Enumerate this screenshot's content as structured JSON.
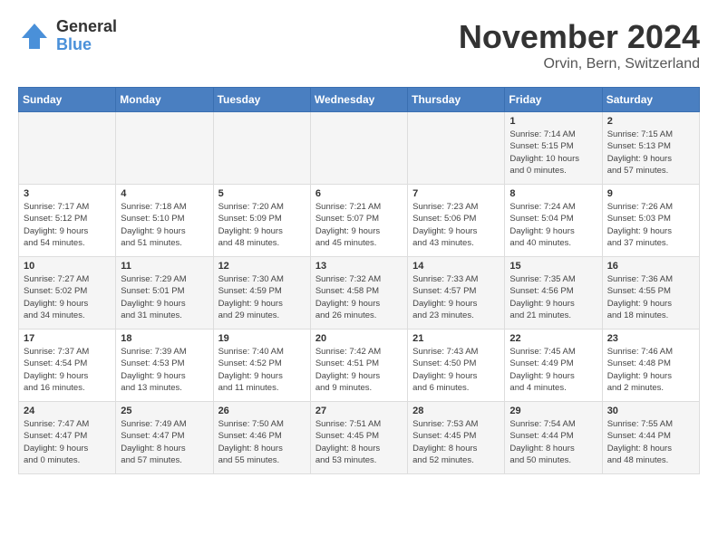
{
  "logo": {
    "general": "General",
    "blue": "Blue"
  },
  "title": "November 2024",
  "location": "Orvin, Bern, Switzerland",
  "days_of_week": [
    "Sunday",
    "Monday",
    "Tuesday",
    "Wednesday",
    "Thursday",
    "Friday",
    "Saturday"
  ],
  "weeks": [
    [
      {
        "day": "",
        "info": ""
      },
      {
        "day": "",
        "info": ""
      },
      {
        "day": "",
        "info": ""
      },
      {
        "day": "",
        "info": ""
      },
      {
        "day": "",
        "info": ""
      },
      {
        "day": "1",
        "info": "Sunrise: 7:14 AM\nSunset: 5:15 PM\nDaylight: 10 hours\nand 0 minutes."
      },
      {
        "day": "2",
        "info": "Sunrise: 7:15 AM\nSunset: 5:13 PM\nDaylight: 9 hours\nand 57 minutes."
      }
    ],
    [
      {
        "day": "3",
        "info": "Sunrise: 7:17 AM\nSunset: 5:12 PM\nDaylight: 9 hours\nand 54 minutes."
      },
      {
        "day": "4",
        "info": "Sunrise: 7:18 AM\nSunset: 5:10 PM\nDaylight: 9 hours\nand 51 minutes."
      },
      {
        "day": "5",
        "info": "Sunrise: 7:20 AM\nSunset: 5:09 PM\nDaylight: 9 hours\nand 48 minutes."
      },
      {
        "day": "6",
        "info": "Sunrise: 7:21 AM\nSunset: 5:07 PM\nDaylight: 9 hours\nand 45 minutes."
      },
      {
        "day": "7",
        "info": "Sunrise: 7:23 AM\nSunset: 5:06 PM\nDaylight: 9 hours\nand 43 minutes."
      },
      {
        "day": "8",
        "info": "Sunrise: 7:24 AM\nSunset: 5:04 PM\nDaylight: 9 hours\nand 40 minutes."
      },
      {
        "day": "9",
        "info": "Sunrise: 7:26 AM\nSunset: 5:03 PM\nDaylight: 9 hours\nand 37 minutes."
      }
    ],
    [
      {
        "day": "10",
        "info": "Sunrise: 7:27 AM\nSunset: 5:02 PM\nDaylight: 9 hours\nand 34 minutes."
      },
      {
        "day": "11",
        "info": "Sunrise: 7:29 AM\nSunset: 5:01 PM\nDaylight: 9 hours\nand 31 minutes."
      },
      {
        "day": "12",
        "info": "Sunrise: 7:30 AM\nSunset: 4:59 PM\nDaylight: 9 hours\nand 29 minutes."
      },
      {
        "day": "13",
        "info": "Sunrise: 7:32 AM\nSunset: 4:58 PM\nDaylight: 9 hours\nand 26 minutes."
      },
      {
        "day": "14",
        "info": "Sunrise: 7:33 AM\nSunset: 4:57 PM\nDaylight: 9 hours\nand 23 minutes."
      },
      {
        "day": "15",
        "info": "Sunrise: 7:35 AM\nSunset: 4:56 PM\nDaylight: 9 hours\nand 21 minutes."
      },
      {
        "day": "16",
        "info": "Sunrise: 7:36 AM\nSunset: 4:55 PM\nDaylight: 9 hours\nand 18 minutes."
      }
    ],
    [
      {
        "day": "17",
        "info": "Sunrise: 7:37 AM\nSunset: 4:54 PM\nDaylight: 9 hours\nand 16 minutes."
      },
      {
        "day": "18",
        "info": "Sunrise: 7:39 AM\nSunset: 4:53 PM\nDaylight: 9 hours\nand 13 minutes."
      },
      {
        "day": "19",
        "info": "Sunrise: 7:40 AM\nSunset: 4:52 PM\nDaylight: 9 hours\nand 11 minutes."
      },
      {
        "day": "20",
        "info": "Sunrise: 7:42 AM\nSunset: 4:51 PM\nDaylight: 9 hours\nand 9 minutes."
      },
      {
        "day": "21",
        "info": "Sunrise: 7:43 AM\nSunset: 4:50 PM\nDaylight: 9 hours\nand 6 minutes."
      },
      {
        "day": "22",
        "info": "Sunrise: 7:45 AM\nSunset: 4:49 PM\nDaylight: 9 hours\nand 4 minutes."
      },
      {
        "day": "23",
        "info": "Sunrise: 7:46 AM\nSunset: 4:48 PM\nDaylight: 9 hours\nand 2 minutes."
      }
    ],
    [
      {
        "day": "24",
        "info": "Sunrise: 7:47 AM\nSunset: 4:47 PM\nDaylight: 9 hours\nand 0 minutes."
      },
      {
        "day": "25",
        "info": "Sunrise: 7:49 AM\nSunset: 4:47 PM\nDaylight: 8 hours\nand 57 minutes."
      },
      {
        "day": "26",
        "info": "Sunrise: 7:50 AM\nSunset: 4:46 PM\nDaylight: 8 hours\nand 55 minutes."
      },
      {
        "day": "27",
        "info": "Sunrise: 7:51 AM\nSunset: 4:45 PM\nDaylight: 8 hours\nand 53 minutes."
      },
      {
        "day": "28",
        "info": "Sunrise: 7:53 AM\nSunset: 4:45 PM\nDaylight: 8 hours\nand 52 minutes."
      },
      {
        "day": "29",
        "info": "Sunrise: 7:54 AM\nSunset: 4:44 PM\nDaylight: 8 hours\nand 50 minutes."
      },
      {
        "day": "30",
        "info": "Sunrise: 7:55 AM\nSunset: 4:44 PM\nDaylight: 8 hours\nand 48 minutes."
      }
    ]
  ]
}
